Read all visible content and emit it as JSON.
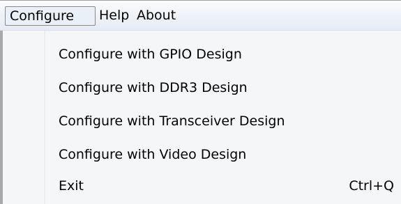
{
  "menubar": {
    "items": [
      {
        "label": "Configure",
        "open": true
      },
      {
        "label": "Help"
      },
      {
        "label": "About"
      }
    ]
  },
  "dropdown": {
    "items": [
      {
        "label": "Configure with GPIO Design",
        "shortcut": ""
      },
      {
        "label": "Configure with DDR3 Design",
        "shortcut": ""
      },
      {
        "label": "Configure with Transceiver Design",
        "shortcut": ""
      },
      {
        "label": "Configure with Video Design",
        "shortcut": ""
      },
      {
        "label": "Exit",
        "shortcut": "Ctrl+Q"
      }
    ]
  }
}
